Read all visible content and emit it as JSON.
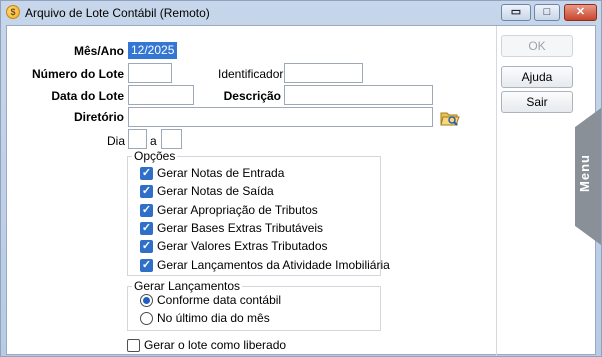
{
  "window": {
    "title": "Arquivo de Lote Contábil (Remoto)",
    "controls": {
      "minimize": "▭",
      "maximize": "□",
      "close": "✕"
    }
  },
  "form": {
    "mes_ano": {
      "label": "Mês/Ano",
      "value": "12/2025"
    },
    "numero_lote": {
      "label": "Número do Lote",
      "value": ""
    },
    "identificador": {
      "label": "Identificador",
      "value": ""
    },
    "data_lote": {
      "label": "Data do Lote",
      "value": ""
    },
    "descricao": {
      "label": "Descrição",
      "value": ""
    },
    "diretorio": {
      "label": "Diretório",
      "value": ""
    },
    "dia": {
      "label": "Dia",
      "from": "",
      "sep": "a",
      "to": ""
    }
  },
  "opcoes": {
    "legend": "Opções",
    "items": [
      {
        "label": "Gerar Notas de Entrada",
        "checked": true
      },
      {
        "label": "Gerar Notas de Saída",
        "checked": true
      },
      {
        "label": "Gerar Apropriação de Tributos",
        "checked": true
      },
      {
        "label": "Gerar Bases Extras Tributáveis",
        "checked": true
      },
      {
        "label": "Gerar Valores Extras Tributados",
        "checked": true
      },
      {
        "label": "Gerar Lançamentos da Atividade Imobiliária",
        "checked": true
      }
    ]
  },
  "gerar_lancamentos": {
    "legend": "Gerar Lançamentos",
    "options": [
      {
        "label": "Conforme data contábil",
        "selected": true
      },
      {
        "label": "No último dia do mês",
        "selected": false
      }
    ]
  },
  "liberado": {
    "label": "Gerar o lote como liberado",
    "checked": false
  },
  "buttons": {
    "ok": "OK",
    "ajuda": "Ajuda",
    "sair": "Sair"
  },
  "side_tab": {
    "label": "Menu"
  },
  "icons": {
    "app": "app-icon",
    "folder": "folder-open-icon"
  }
}
